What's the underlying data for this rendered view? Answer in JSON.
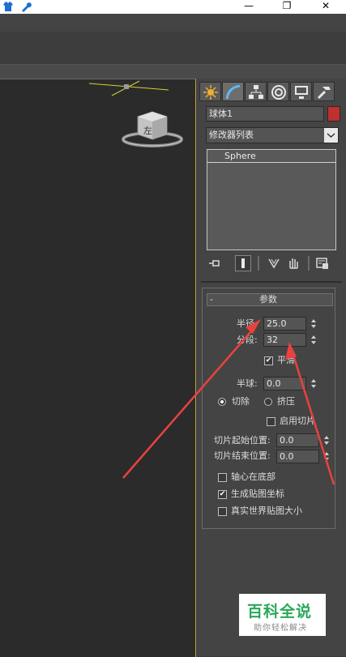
{
  "titlebar": {
    "min_glyph": "—",
    "max_glyph": "❐",
    "close_glyph": "✕"
  },
  "object": {
    "name": "球体1",
    "color": "#c0302e"
  },
  "modifier_list": {
    "label": "修改器列表"
  },
  "stack": {
    "items": [
      "Sphere"
    ]
  },
  "rollout": {
    "collapse": "-",
    "title": "参数"
  },
  "params": {
    "radius_label": "半径:",
    "radius_value": "25.0",
    "segments_label": "分段:",
    "segments_value": "32",
    "smooth_label": "平滑",
    "smooth_checked": true,
    "hemisphere_label": "半球:",
    "hemisphere_value": "0.0",
    "chop_label": "切除",
    "squash_label": "挤压",
    "chop_selected": true,
    "slice_on_label": "启用切片",
    "slice_from_label": "切片起始位置:",
    "slice_from_value": "0.0",
    "slice_to_label": "切片结束位置:",
    "slice_to_value": "0.0",
    "base_to_pivot_label": "轴心在底部",
    "gen_map_label": "生成贴图坐标",
    "gen_map_checked": true,
    "real_world_label": "真实世界贴图大小"
  },
  "viewcube": {
    "face_label": "左"
  },
  "watermark": {
    "title": "百科全说",
    "subtitle": "助你轻松解决"
  },
  "colors": {
    "annotation_arrow": "#e8423f",
    "viewport_border": "#c9a437",
    "panel_bg": "#444444"
  }
}
